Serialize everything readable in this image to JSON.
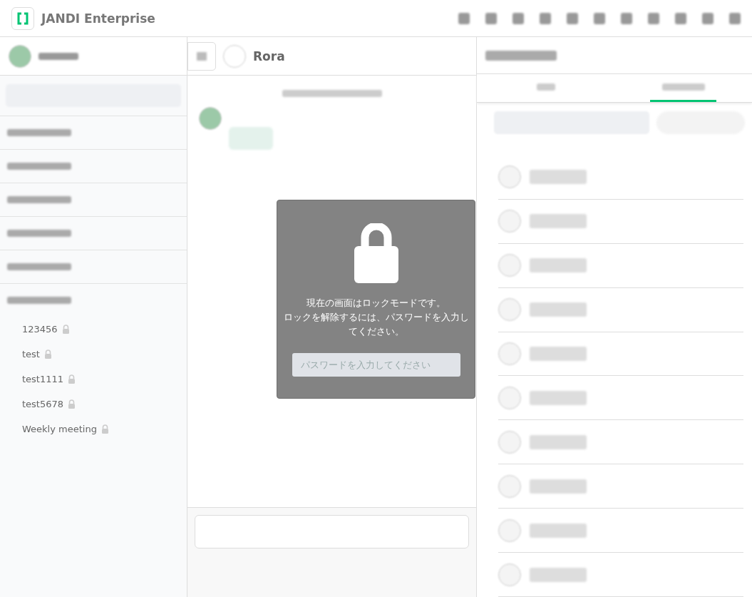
{
  "header": {
    "workspace": "JANDI Enterprise"
  },
  "sidebar": {
    "topics": [
      {
        "name": "123456",
        "locked": true
      },
      {
        "name": "test",
        "locked": true
      },
      {
        "name": "test1111",
        "locked": true
      },
      {
        "name": "test5678",
        "locked": true
      },
      {
        "name": "Weekly meeting",
        "locked": true
      }
    ]
  },
  "chat": {
    "title": "Rora"
  },
  "right_panel": {
    "tabs": [
      {
        "selected": false
      },
      {
        "selected": true
      }
    ]
  },
  "lock_dialog": {
    "message": [
      "現在の画面はロックモードです。",
      "ロックを解除するには、パスワードを入力してください。"
    ],
    "placeholder": "パスワードを入力してください"
  }
}
